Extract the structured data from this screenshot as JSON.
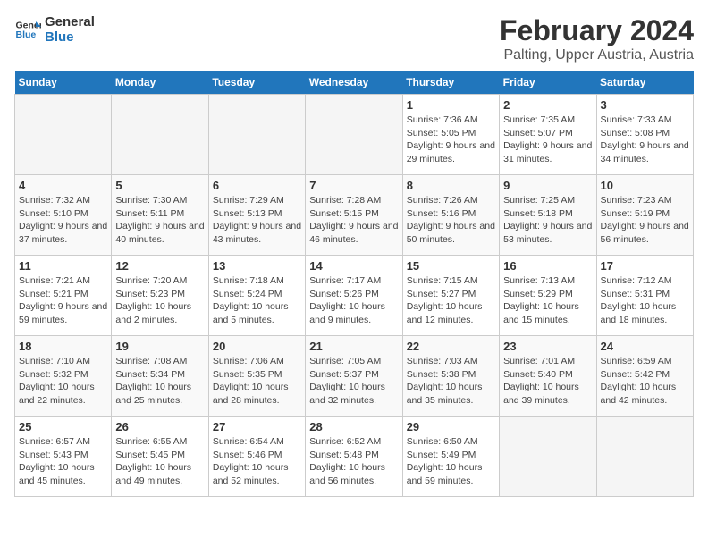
{
  "header": {
    "logo_line1": "General",
    "logo_line2": "Blue",
    "title": "February 2024",
    "subtitle": "Palting, Upper Austria, Austria"
  },
  "weekdays": [
    "Sunday",
    "Monday",
    "Tuesday",
    "Wednesday",
    "Thursday",
    "Friday",
    "Saturday"
  ],
  "weeks": [
    [
      {
        "day": "",
        "info": ""
      },
      {
        "day": "",
        "info": ""
      },
      {
        "day": "",
        "info": ""
      },
      {
        "day": "",
        "info": ""
      },
      {
        "day": "1",
        "info": "Sunrise: 7:36 AM\nSunset: 5:05 PM\nDaylight: 9 hours and 29 minutes."
      },
      {
        "day": "2",
        "info": "Sunrise: 7:35 AM\nSunset: 5:07 PM\nDaylight: 9 hours and 31 minutes."
      },
      {
        "day": "3",
        "info": "Sunrise: 7:33 AM\nSunset: 5:08 PM\nDaylight: 9 hours and 34 minutes."
      }
    ],
    [
      {
        "day": "4",
        "info": "Sunrise: 7:32 AM\nSunset: 5:10 PM\nDaylight: 9 hours and 37 minutes."
      },
      {
        "day": "5",
        "info": "Sunrise: 7:30 AM\nSunset: 5:11 PM\nDaylight: 9 hours and 40 minutes."
      },
      {
        "day": "6",
        "info": "Sunrise: 7:29 AM\nSunset: 5:13 PM\nDaylight: 9 hours and 43 minutes."
      },
      {
        "day": "7",
        "info": "Sunrise: 7:28 AM\nSunset: 5:15 PM\nDaylight: 9 hours and 46 minutes."
      },
      {
        "day": "8",
        "info": "Sunrise: 7:26 AM\nSunset: 5:16 PM\nDaylight: 9 hours and 50 minutes."
      },
      {
        "day": "9",
        "info": "Sunrise: 7:25 AM\nSunset: 5:18 PM\nDaylight: 9 hours and 53 minutes."
      },
      {
        "day": "10",
        "info": "Sunrise: 7:23 AM\nSunset: 5:19 PM\nDaylight: 9 hours and 56 minutes."
      }
    ],
    [
      {
        "day": "11",
        "info": "Sunrise: 7:21 AM\nSunset: 5:21 PM\nDaylight: 9 hours and 59 minutes."
      },
      {
        "day": "12",
        "info": "Sunrise: 7:20 AM\nSunset: 5:23 PM\nDaylight: 10 hours and 2 minutes."
      },
      {
        "day": "13",
        "info": "Sunrise: 7:18 AM\nSunset: 5:24 PM\nDaylight: 10 hours and 5 minutes."
      },
      {
        "day": "14",
        "info": "Sunrise: 7:17 AM\nSunset: 5:26 PM\nDaylight: 10 hours and 9 minutes."
      },
      {
        "day": "15",
        "info": "Sunrise: 7:15 AM\nSunset: 5:27 PM\nDaylight: 10 hours and 12 minutes."
      },
      {
        "day": "16",
        "info": "Sunrise: 7:13 AM\nSunset: 5:29 PM\nDaylight: 10 hours and 15 minutes."
      },
      {
        "day": "17",
        "info": "Sunrise: 7:12 AM\nSunset: 5:31 PM\nDaylight: 10 hours and 18 minutes."
      }
    ],
    [
      {
        "day": "18",
        "info": "Sunrise: 7:10 AM\nSunset: 5:32 PM\nDaylight: 10 hours and 22 minutes."
      },
      {
        "day": "19",
        "info": "Sunrise: 7:08 AM\nSunset: 5:34 PM\nDaylight: 10 hours and 25 minutes."
      },
      {
        "day": "20",
        "info": "Sunrise: 7:06 AM\nSunset: 5:35 PM\nDaylight: 10 hours and 28 minutes."
      },
      {
        "day": "21",
        "info": "Sunrise: 7:05 AM\nSunset: 5:37 PM\nDaylight: 10 hours and 32 minutes."
      },
      {
        "day": "22",
        "info": "Sunrise: 7:03 AM\nSunset: 5:38 PM\nDaylight: 10 hours and 35 minutes."
      },
      {
        "day": "23",
        "info": "Sunrise: 7:01 AM\nSunset: 5:40 PM\nDaylight: 10 hours and 39 minutes."
      },
      {
        "day": "24",
        "info": "Sunrise: 6:59 AM\nSunset: 5:42 PM\nDaylight: 10 hours and 42 minutes."
      }
    ],
    [
      {
        "day": "25",
        "info": "Sunrise: 6:57 AM\nSunset: 5:43 PM\nDaylight: 10 hours and 45 minutes."
      },
      {
        "day": "26",
        "info": "Sunrise: 6:55 AM\nSunset: 5:45 PM\nDaylight: 10 hours and 49 minutes."
      },
      {
        "day": "27",
        "info": "Sunrise: 6:54 AM\nSunset: 5:46 PM\nDaylight: 10 hours and 52 minutes."
      },
      {
        "day": "28",
        "info": "Sunrise: 6:52 AM\nSunset: 5:48 PM\nDaylight: 10 hours and 56 minutes."
      },
      {
        "day": "29",
        "info": "Sunrise: 6:50 AM\nSunset: 5:49 PM\nDaylight: 10 hours and 59 minutes."
      },
      {
        "day": "",
        "info": ""
      },
      {
        "day": "",
        "info": ""
      }
    ]
  ]
}
